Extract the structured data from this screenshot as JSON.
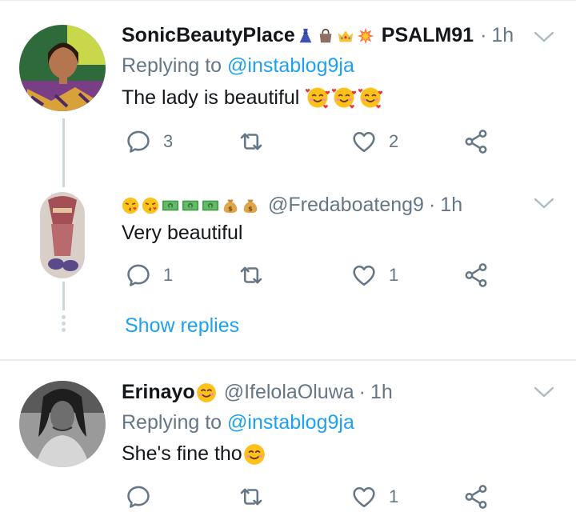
{
  "colors": {
    "accent": "#1da1f2",
    "muted": "#657786",
    "text": "#14171a"
  },
  "tweets": [
    {
      "display_name": "SonicBeautyPlace",
      "name_suffix": "PSALM91",
      "name_emojis": [
        "dress-emoji",
        "handbag-emoji",
        "crown-emoji",
        "collision-emoji"
      ],
      "time": "1h",
      "replying_prefix": "Replying to",
      "replying_handle": "@instablog9ja",
      "text": "The lady is beautiful",
      "text_emojis": [
        "smiling-face-with-hearts-emoji",
        "smiling-face-with-hearts-emoji",
        "smiling-face-with-hearts-emoji"
      ],
      "replies": "3",
      "retweets": "",
      "likes": "2"
    },
    {
      "display_name_emojis": [
        "face-blowing-kiss-emoji",
        "face-blowing-kiss-emoji",
        "dollar-banknote-emoji",
        "dollar-banknote-emoji",
        "dollar-banknote-emoji",
        "money-bag-emoji",
        "money-bag-emoji"
      ],
      "handle": "@Fredaboateng9",
      "time": "1h",
      "text": "Very beautiful",
      "replies": "1",
      "retweets": "",
      "likes": "1",
      "show_replies": "Show replies"
    },
    {
      "display_name": "Erinayo",
      "name_emoji": "smiling-face-emoji",
      "handle": "@IfelolaOluwa",
      "time": "1h",
      "replying_prefix": "Replying to",
      "replying_handle": "@instablog9ja",
      "text": "She's fine tho",
      "text_emoji": "smiling-face-emoji",
      "replies": "",
      "retweets": "",
      "likes": "1"
    }
  ],
  "separator_dot": "·"
}
